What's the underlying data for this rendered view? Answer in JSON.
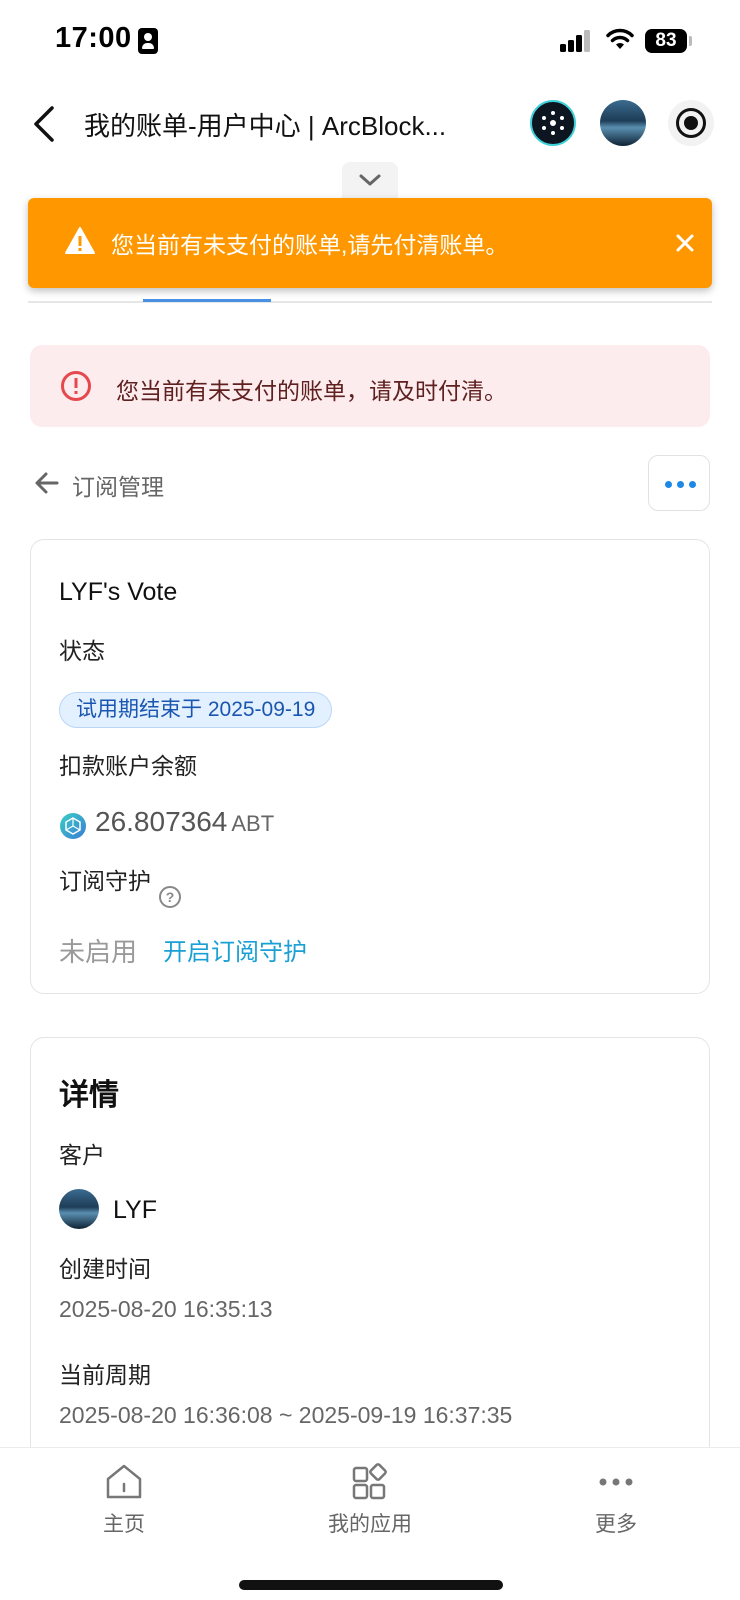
{
  "status_bar": {
    "time": "17:00",
    "battery": "83"
  },
  "nav": {
    "title": "我的账单-用户中心 | ArcBlock..."
  },
  "toast": {
    "message": "您当前有未支付的账单,请先付清账单。"
  },
  "alert": {
    "message": "您当前有未支付的账单，请及时付清。"
  },
  "breadcrumb": {
    "label": "订阅管理"
  },
  "subscription": {
    "name": "LYF's Vote",
    "status_label": "状态",
    "status_value": "试用期结束于 2025-09-19",
    "balance_label": "扣款账户余额",
    "balance_amount": "26.807364",
    "balance_unit": "ABT",
    "protection_label": "订阅守护",
    "protection_status": "未启用",
    "protection_action": "开启订阅守护"
  },
  "details": {
    "heading": "详情",
    "customer_label": "客户",
    "customer_name": "LYF",
    "created_label": "创建时间",
    "created_value": "2025-08-20 16:35:13",
    "period_label": "当前周期",
    "period_value": "2025-08-20 16:36:08 ~ 2025-09-19 16:37:35"
  },
  "bottom_nav": {
    "home": "主页",
    "apps": "我的应用",
    "more": "更多"
  },
  "colors": {
    "toast_bg": "#ff9800",
    "alert_bg": "#fdecee",
    "accent_blue": "#1e88e5",
    "link": "#1aa0d4"
  }
}
